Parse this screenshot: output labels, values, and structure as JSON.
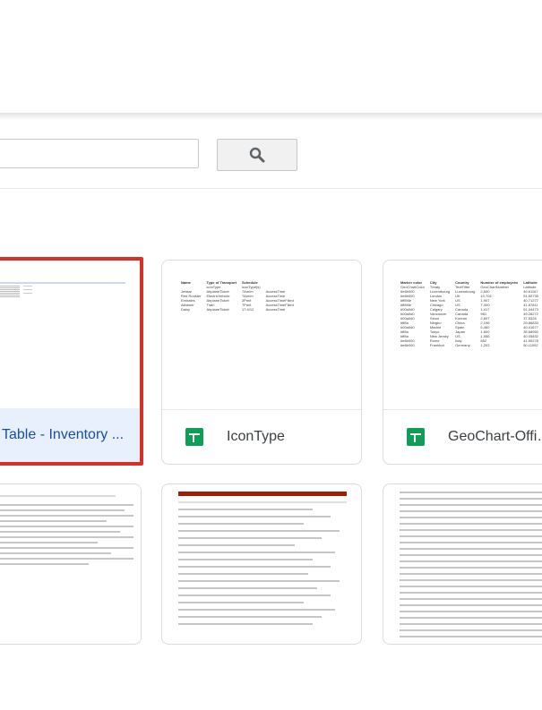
{
  "search": {
    "placeholder": ""
  },
  "cards": [
    {
      "title": "Table - Inventory ...",
      "selected": true
    },
    {
      "title": "IconType",
      "preview": {
        "headers": [
          "Name",
          "Type of Transport",
          "Schedule"
        ],
        "rows": [
          [
            "",
            "iconType",
            "iconType(s)"
          ],
          [
            "Jetstar",
            "AirplaneTicket",
            "7Am/m"
          ],
          [
            "Red Rooster",
            "ElectricVehicle",
            "7Am/m"
          ],
          [
            "Emirates",
            "AirplaneTicket",
            "2Pm/t"
          ],
          [
            "Altrawer",
            "Train",
            "7Pm/t"
          ],
          [
            "Daisy",
            "AirplaneTicket",
            "17:4/12"
          ]
        ],
        "extra": [
          "",
          "AccessTime",
          "AccessTime",
          "AccessTimeFilled",
          "AccessTimeFilled",
          "AccessTime"
        ]
      }
    },
    {
      "title": "GeoChart-Office",
      "preview": {
        "headers": [
          "Marker color",
          "City",
          "Country",
          "Number of employees",
          "Latitude"
        ],
        "rows": [
          [
            "GeoChartColor",
            "Treaty",
            "TextFilter",
            "GeoChartNumber",
            "Latitude"
          ],
          [
            "#e6b000",
            "Luxembourg",
            "Luxembourg",
            "2,600",
            "49.61167"
          ],
          [
            "#e6b000",
            "London",
            "UK",
            "10,704",
            "51.50735"
          ],
          [
            "#ff8f4e",
            "New York",
            "US",
            "1,907",
            "40.71277"
          ],
          [
            "#ff8f4e",
            "Chicago",
            "US",
            "7,300",
            "41.87811"
          ],
          [
            "#00a0d0",
            "Calgary",
            "Canada",
            "1,417",
            "51.04473"
          ],
          [
            "#00a0d0",
            "Vancouver",
            "Canada",
            "981",
            "49.28272"
          ],
          [
            "#00a0d0",
            "Seoul",
            "Korean",
            "2,607",
            "37.5326"
          ],
          [
            "#ff8a",
            "Ningbo",
            "China",
            "2,198",
            "29.86833"
          ],
          [
            "#00a0d0",
            "Madrid",
            "Spain",
            "5,460",
            "40.41677"
          ],
          [
            "#ff8a",
            "Tokyo",
            "Japan",
            "1,600",
            "35.68950"
          ],
          [
            "#ff8a",
            "New Jersey",
            "US",
            "1,556",
            "40.05832"
          ],
          [
            "#e6b000",
            "Rome",
            "Italy",
            "852",
            "41.90278"
          ],
          [
            "#e6b000",
            "Frankfurt",
            "Germany",
            "1,203",
            "50.11092"
          ]
        ]
      }
    },
    {
      "title": ""
    },
    {
      "title": ""
    },
    {
      "title": ""
    }
  ]
}
